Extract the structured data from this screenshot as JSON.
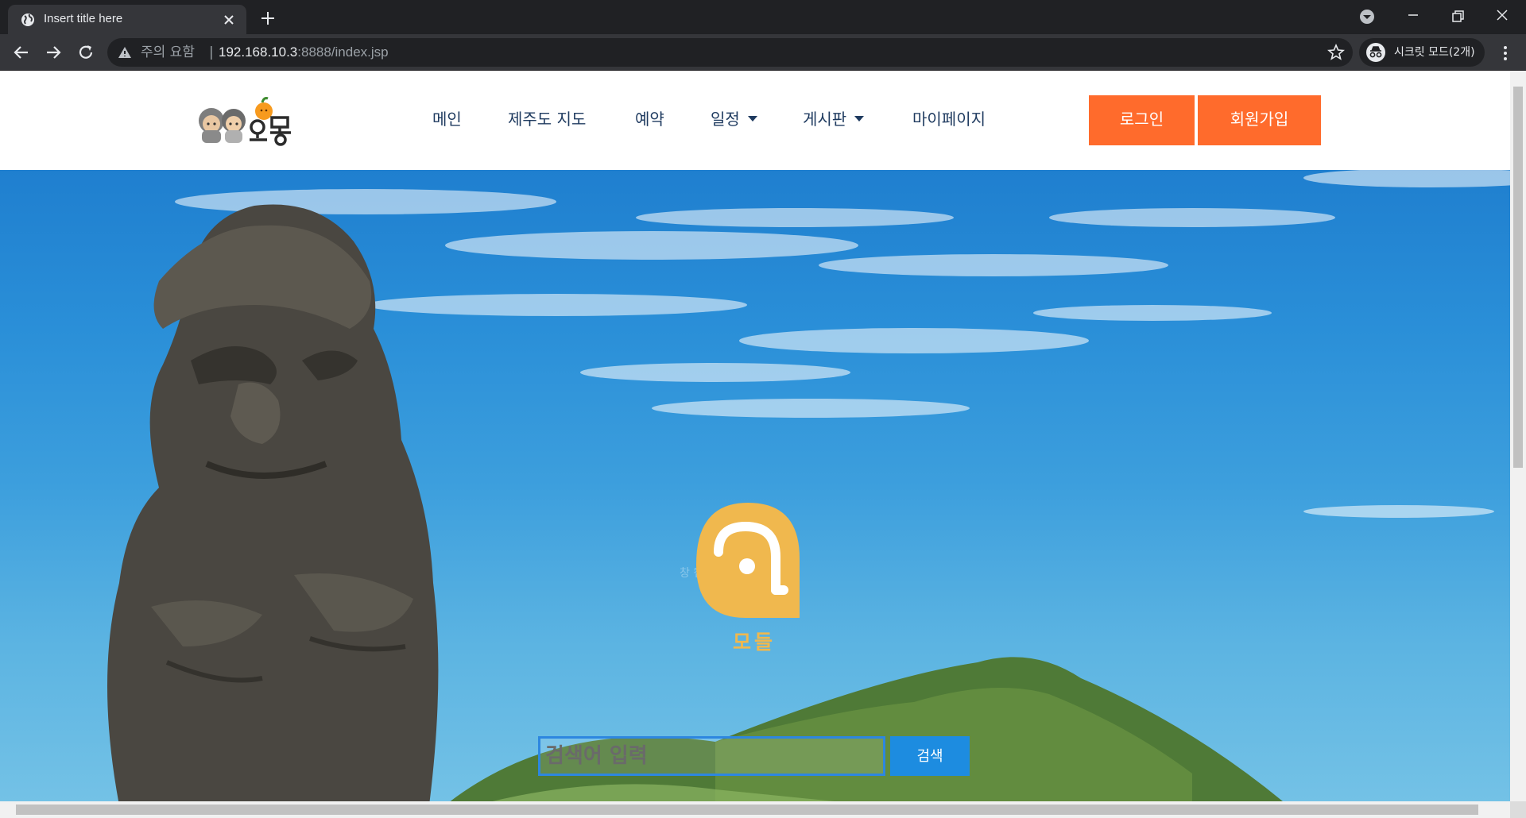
{
  "browser": {
    "tab_title": "Insert title here",
    "security_warning": "주의 요함",
    "separator": "|",
    "url_host": "192.168.10.3",
    "url_path": ":8888/index.jsp",
    "incognito_label": "시크릿 모드(2개)",
    "icons": [
      "globe-icon",
      "close-icon",
      "plus-icon",
      "back-icon",
      "forward-icon",
      "reload-icon",
      "warning-icon",
      "star-icon",
      "incognito-icon",
      "more-icon",
      "minimize-icon",
      "restore-icon",
      "dropdown-icon"
    ]
  },
  "site": {
    "nav": {
      "main": "메인",
      "map": "제주도 지도",
      "reservation": "예약",
      "schedule": "일정",
      "board": "게시판",
      "mypage": "마이페이지"
    },
    "login_label": "로그인",
    "signup_label": "회원가입",
    "accent_color": "#ff6b2c",
    "nav_color": "#1e3a5f"
  },
  "hero": {
    "popup_label": "창 캡처(W)",
    "app_name": "모들",
    "search_placeholder": "검색어 입력",
    "search_button": "검색",
    "logo_color": "#f0b84e",
    "search_color": "#1d8ce0"
  }
}
